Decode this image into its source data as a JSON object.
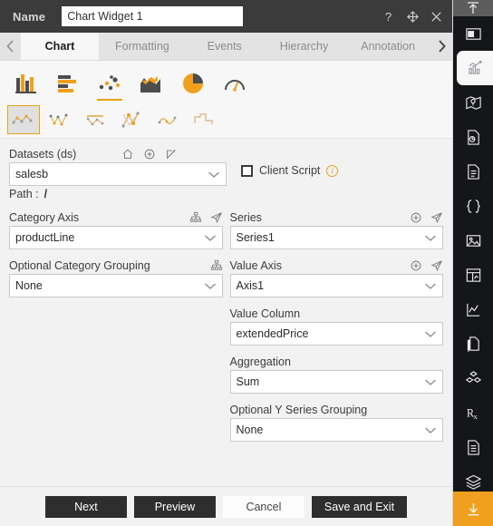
{
  "window": {
    "name_label": "Name",
    "widget_name": "Chart Widget 1",
    "name_placeholder": "Chart Widget 1",
    "icons": {
      "help": "help-icon",
      "move": "move-icon",
      "close": "close-icon"
    }
  },
  "tabs": {
    "prev_arrow": "‹",
    "next_arrow": "›",
    "items": [
      {
        "label": "Chart",
        "active": true
      },
      {
        "label": "Formatting",
        "active": false
      },
      {
        "label": "Events",
        "active": false
      },
      {
        "label": "Hierarchy",
        "active": false
      },
      {
        "label": "Annotation",
        "active": false
      }
    ]
  },
  "chart_types": {
    "primary": [
      {
        "name": "column-chart-icon",
        "selected": false
      },
      {
        "name": "bar-chart-icon",
        "selected": false
      },
      {
        "name": "scatter-chart-icon",
        "selected": true
      },
      {
        "name": "area-chart-icon",
        "selected": false
      },
      {
        "name": "pie-chart-icon",
        "selected": false
      },
      {
        "name": "gauge-chart-icon",
        "selected": false
      }
    ],
    "subtypes": [
      {
        "name": "scatter-plain-icon",
        "selected": true
      },
      {
        "name": "scatter-marker-icon",
        "selected": false
      },
      {
        "name": "scatter-line-icon",
        "selected": false
      },
      {
        "name": "scatter-bubble-icon",
        "selected": false
      },
      {
        "name": "scatter-smooth-icon",
        "selected": false
      },
      {
        "name": "scatter-step-icon",
        "selected": false
      }
    ]
  },
  "datasets": {
    "label": "Datasets (ds)",
    "value": "salesb",
    "path_label": "Path :",
    "path_value": "/",
    "icons": [
      "home-icon",
      "add-icon",
      "edit-icon"
    ],
    "client_script": {
      "label": "Client Script",
      "checked": false,
      "info": "i"
    }
  },
  "category_axis": {
    "label": "Category Axis",
    "value": "productLine",
    "icons": [
      "hierarchy-icon",
      "send-icon"
    ]
  },
  "category_grouping": {
    "label": "Optional Category Grouping",
    "value": "None",
    "icons": [
      "hierarchy-icon"
    ]
  },
  "series": {
    "label": "Series",
    "value": "Series1",
    "icons": [
      "add-circle-icon",
      "send-icon"
    ]
  },
  "value_axis": {
    "label": "Value Axis",
    "value": "Axis1",
    "icons": [
      "add-circle-icon",
      "send-icon"
    ]
  },
  "value_column": {
    "label": "Value Column",
    "value": "extendedPrice"
  },
  "aggregation": {
    "label": "Aggregation",
    "value": "Sum"
  },
  "y_series_grouping": {
    "label": "Optional Y Series Grouping",
    "value": "None"
  },
  "footer": {
    "next": "Next",
    "preview": "Preview",
    "cancel": "Cancel",
    "save_and_exit": "Save and Exit"
  },
  "rail": {
    "top": "collapse-up-icon",
    "items": [
      {
        "name": "layout-icon",
        "active": false
      },
      {
        "name": "chart-widget-icon",
        "active": true
      },
      {
        "name": "map-icon",
        "active": false
      },
      {
        "name": "report-icon",
        "active": false
      },
      {
        "name": "document-icon",
        "active": false
      },
      {
        "name": "code-braces-icon",
        "active": false
      },
      {
        "name": "image-icon",
        "active": false
      },
      {
        "name": "table-widget-icon",
        "active": false
      },
      {
        "name": "sparkline-icon",
        "active": false
      },
      {
        "name": "file-copy-icon",
        "active": false
      },
      {
        "name": "cube-group-icon",
        "active": false
      },
      {
        "name": "prescription-icon",
        "active": false
      },
      {
        "name": "list-document-icon",
        "active": false
      },
      {
        "name": "layers-icon",
        "active": false
      },
      {
        "name": "grid-icon",
        "active": false
      }
    ],
    "bottom": "download-icon"
  },
  "colors": {
    "accent": "#e8a317",
    "titlebar": "#3b3b3b",
    "rail": "#15161a",
    "download": "#f0a01e",
    "panel": "#f2f2f2"
  }
}
